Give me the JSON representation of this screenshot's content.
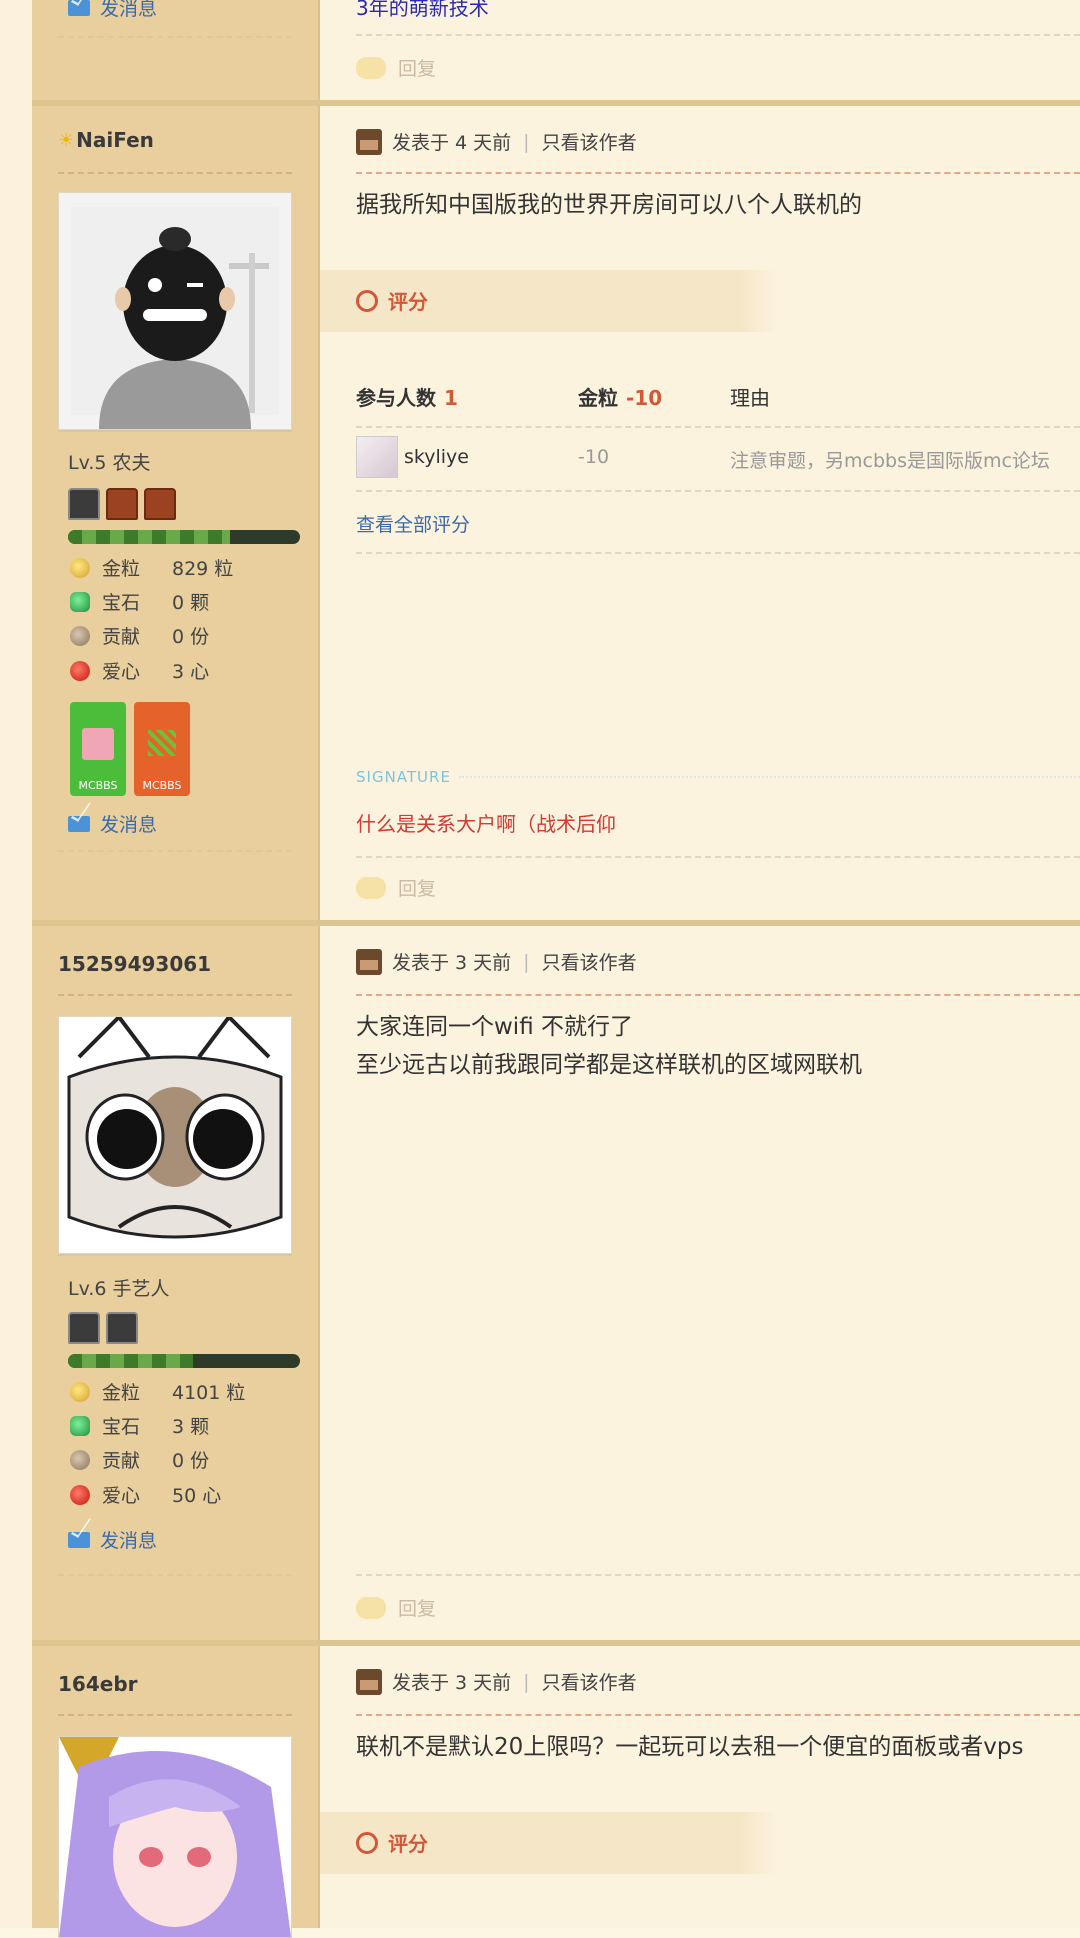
{
  "top": {
    "prev_send_msg": "发消息",
    "prev_text": "3年的萌新技术",
    "prev_reply": "回复"
  },
  "posts": [
    {
      "username": "NaiFen",
      "avatar": "avatar-bearded-man",
      "level": "Lv.5 农夫",
      "stats": [
        {
          "label": "金粒",
          "value": "829 粒"
        },
        {
          "label": "宝石",
          "value": "0 颗"
        },
        {
          "label": "贡献",
          "value": "0 份"
        },
        {
          "label": "爱心",
          "value": "3 心"
        }
      ],
      "badges": [
        "MCBBS",
        "MCBBS"
      ],
      "send_msg": "发消息",
      "posted": "发表于 4 天前",
      "only_author": "只看该作者",
      "content": [
        "据我所知中国版我的世界开房间可以八个人联机的"
      ],
      "rating": {
        "label": "评分",
        "participants_label": "参与人数",
        "participants": "1",
        "gold_label": "金粒",
        "gold_total": "-10",
        "reason_label": "理由",
        "rows": [
          {
            "user": "skyliye",
            "gold": "-10",
            "reason": "注意审题，另mcbbs是国际版mc论坛"
          }
        ],
        "view_all": "查看全部评分"
      },
      "signature_label": "SIGNATURE",
      "signature": "什么是关系大户啊（战术后仰",
      "reply": "回复"
    },
    {
      "username": "15259493061",
      "avatar": "avatar-cat",
      "level": "Lv.6 手艺人",
      "stats": [
        {
          "label": "金粒",
          "value": "4101 粒"
        },
        {
          "label": "宝石",
          "value": "3 颗"
        },
        {
          "label": "贡献",
          "value": "0 份"
        },
        {
          "label": "爱心",
          "value": "50 心"
        }
      ],
      "send_msg": "发消息",
      "posted": "发表于 3 天前",
      "only_author": "只看该作者",
      "content": [
        "大家连同一个wifi 不就行了",
        "至少远古以前我跟同学都是这样联机的区域网联机"
      ],
      "reply": "回复"
    },
    {
      "username": "164ebr",
      "avatar": "avatar-anime-girl",
      "posted": "发表于 3 天前",
      "only_author": "只看该作者",
      "content": [
        "联机不是默认20上限吗？一起玩可以去租一个便宜的面板或者vps"
      ],
      "rating_label": "评分"
    }
  ]
}
